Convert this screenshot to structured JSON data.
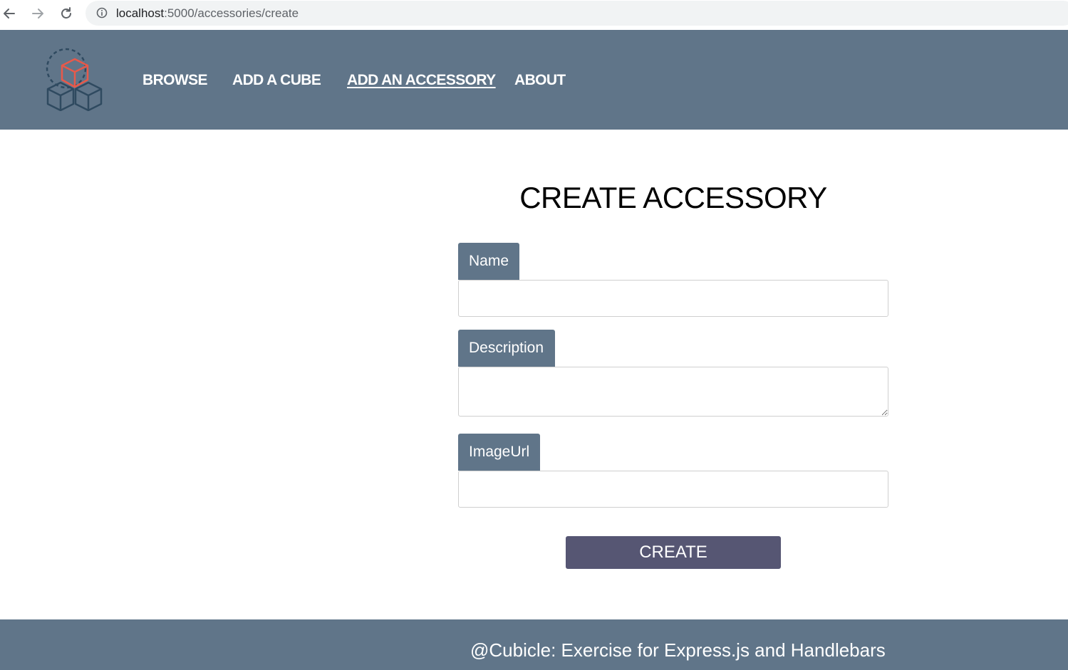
{
  "browser": {
    "url_host": "localhost",
    "url_path": ":5000/accessories/create"
  },
  "header": {
    "logo_name": "cubicle-logo",
    "nav": [
      {
        "label": "BROWSE",
        "active": false
      },
      {
        "label": "ADD A CUBE",
        "active": false
      },
      {
        "label": "ADD AN ACCESSORY",
        "active": true
      },
      {
        "label": "ABOUT",
        "active": false
      }
    ]
  },
  "form": {
    "title": "CREATE ACCESSORY",
    "fields": [
      {
        "label": "Name",
        "value": "",
        "type": "text"
      },
      {
        "label": "Description",
        "value": "",
        "type": "textarea"
      },
      {
        "label": "ImageUrl",
        "value": "",
        "type": "text"
      }
    ],
    "submit_label": "CREATE"
  },
  "footer": {
    "text": "@Cubicle: Exercise for Express.js and Handlebars"
  },
  "colors": {
    "header_bg": "#607589",
    "button_bg": "#565673",
    "logo_accent": "#e8594a",
    "logo_dark": "#2f4a60"
  }
}
